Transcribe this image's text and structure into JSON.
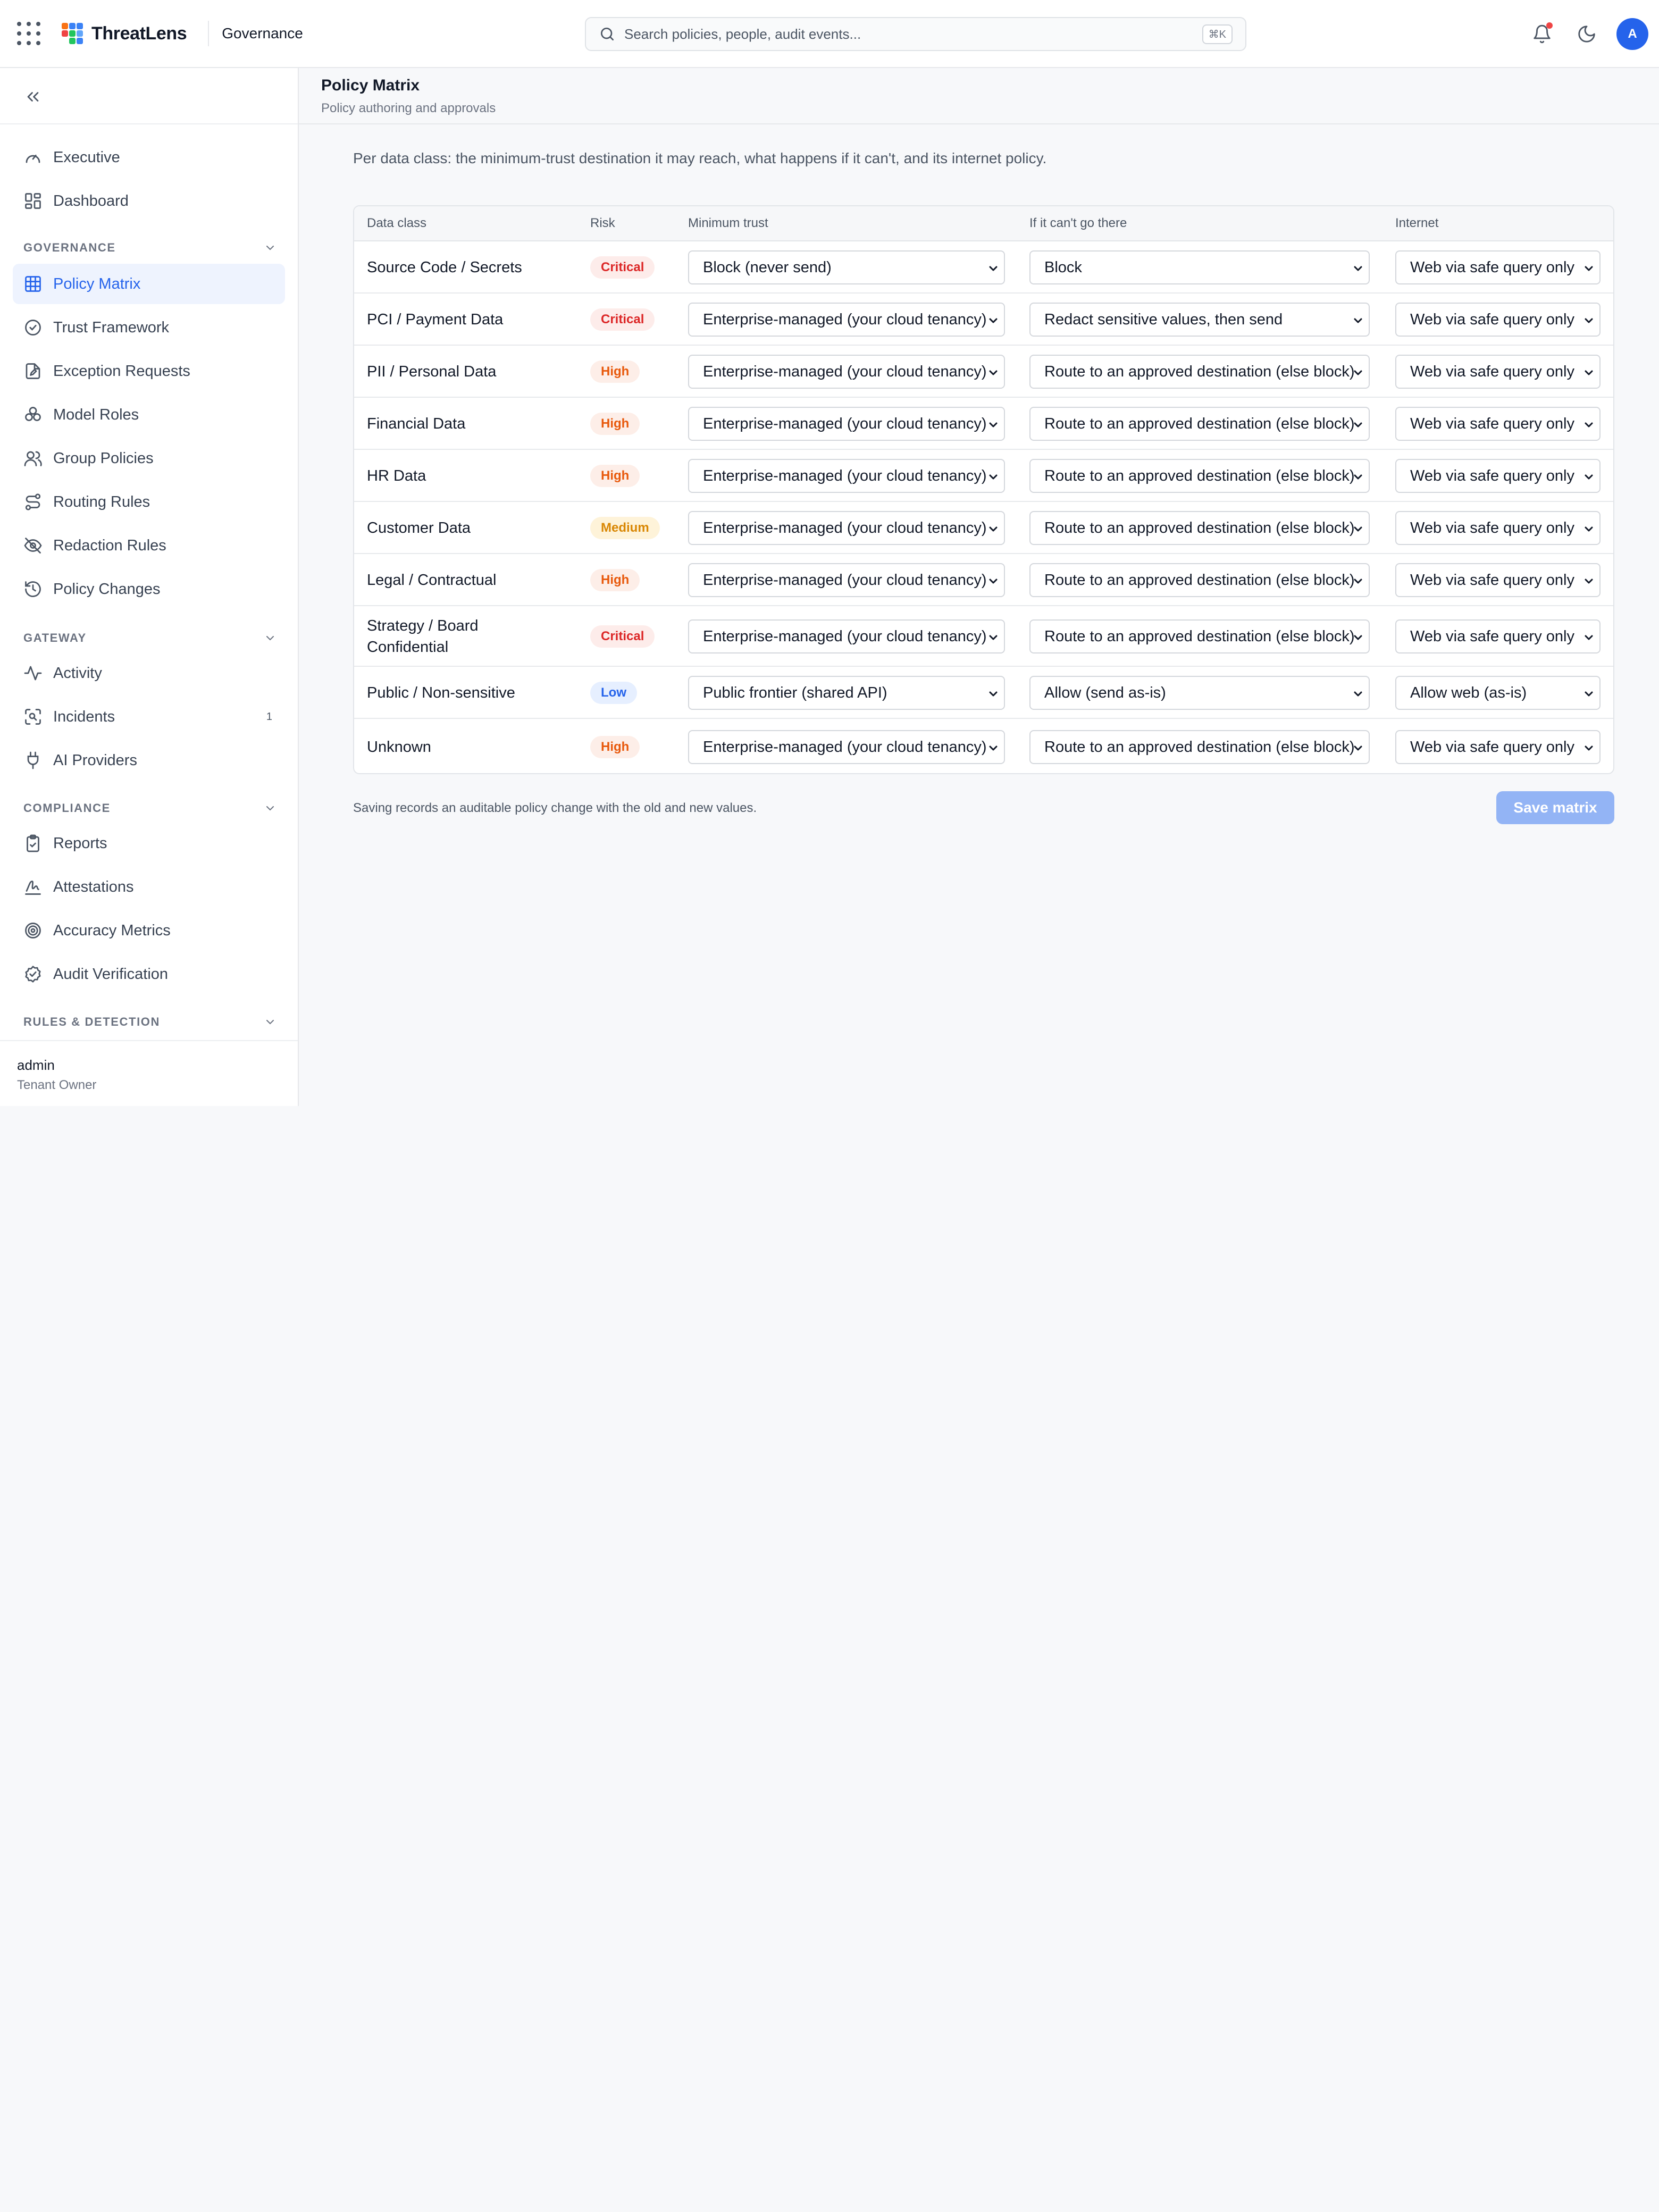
{
  "app": {
    "name": "ThreatLens",
    "section": "Governance"
  },
  "brand_colors": {
    "accent": "#2563eb",
    "critical": "#dc2626",
    "high": "#e8590c",
    "medium": "#d98704",
    "low": "#2563eb"
  },
  "search": {
    "placeholder": "Search policies, people, audit events...",
    "shortcut": "⌘K"
  },
  "sidebar": {
    "top_items": [
      {
        "label": "Executive",
        "icon": "gauge-icon"
      },
      {
        "label": "Dashboard",
        "icon": "dashboard-icon"
      }
    ],
    "groups": [
      {
        "label": "GOVERNANCE",
        "items": [
          {
            "label": "Policy Matrix",
            "icon": "grid-icon",
            "active": true
          },
          {
            "label": "Trust Framework",
            "icon": "check-circle-icon"
          },
          {
            "label": "Exception Requests",
            "icon": "file-edit-icon"
          },
          {
            "label": "Model Roles",
            "icon": "boxes-icon"
          },
          {
            "label": "Group Policies",
            "icon": "users-icon"
          },
          {
            "label": "Routing Rules",
            "icon": "route-icon"
          },
          {
            "label": "Redaction Rules",
            "icon": "eye-off-icon"
          },
          {
            "label": "Policy Changes",
            "icon": "history-icon"
          }
        ]
      },
      {
        "label": "GATEWAY",
        "items": [
          {
            "label": "Activity",
            "icon": "activity-icon"
          },
          {
            "label": "Incidents",
            "icon": "scan-icon",
            "badge": "1"
          },
          {
            "label": "AI Providers",
            "icon": "plug-icon"
          }
        ]
      },
      {
        "label": "COMPLIANCE",
        "items": [
          {
            "label": "Reports",
            "icon": "clipboard-check-icon"
          },
          {
            "label": "Attestations",
            "icon": "signature-icon"
          },
          {
            "label": "Accuracy Metrics",
            "icon": "target-icon"
          },
          {
            "label": "Audit Verification",
            "icon": "badge-check-icon"
          }
        ]
      },
      {
        "label": "RULES & DETECTION",
        "items": []
      }
    ],
    "user": {
      "name": "admin",
      "role": "Tenant Owner"
    }
  },
  "page": {
    "title": "Policy Matrix",
    "subtitle": "Policy authoring and approvals",
    "intro": "Per data class: the minimum-trust destination it may reach, what happens if it can't, and its internet policy."
  },
  "table": {
    "columns": [
      "Data class",
      "Risk",
      "Minimum trust",
      "If it can't go there",
      "Internet"
    ],
    "rows": [
      {
        "data_class": "Source Code / Secrets",
        "risk": "Critical",
        "min_trust": "Block (never send)",
        "fallback": "Block",
        "internet": "Web via safe query only"
      },
      {
        "data_class": "PCI / Payment Data",
        "risk": "Critical",
        "min_trust": "Enterprise-managed (your cloud tenancy)",
        "fallback": "Redact sensitive values, then send",
        "internet": "Web via safe query only"
      },
      {
        "data_class": "PII / Personal Data",
        "risk": "High",
        "min_trust": "Enterprise-managed (your cloud tenancy)",
        "fallback": "Route to an approved destination (else block)",
        "internet": "Web via safe query only"
      },
      {
        "data_class": "Financial Data",
        "risk": "High",
        "min_trust": "Enterprise-managed (your cloud tenancy)",
        "fallback": "Route to an approved destination (else block)",
        "internet": "Web via safe query only"
      },
      {
        "data_class": "HR Data",
        "risk": "High",
        "min_trust": "Enterprise-managed (your cloud tenancy)",
        "fallback": "Route to an approved destination (else block)",
        "internet": "Web via safe query only"
      },
      {
        "data_class": "Customer Data",
        "risk": "Medium",
        "min_trust": "Enterprise-managed (your cloud tenancy)",
        "fallback": "Route to an approved destination (else block)",
        "internet": "Web via safe query only"
      },
      {
        "data_class": "Legal / Contractual",
        "risk": "High",
        "min_trust": "Enterprise-managed (your cloud tenancy)",
        "fallback": "Route to an approved destination (else block)",
        "internet": "Web via safe query only"
      },
      {
        "data_class": "Strategy / Board Confidential",
        "risk": "Critical",
        "min_trust": "Enterprise-managed (your cloud tenancy)",
        "fallback": "Route to an approved destination (else block)",
        "internet": "Web via safe query only"
      },
      {
        "data_class": "Public / Non-sensitive",
        "risk": "Low",
        "min_trust": "Public frontier (shared API)",
        "fallback": "Allow (send as-is)",
        "internet": "Allow web (as-is)"
      },
      {
        "data_class": "Unknown",
        "risk": "High",
        "min_trust": "Enterprise-managed (your cloud tenancy)",
        "fallback": "Route to an approved destination (else block)",
        "internet": "Web via safe query only"
      }
    ]
  },
  "footer": {
    "note": "Saving records an auditable policy change with the old and new values.",
    "save_label": "Save matrix"
  },
  "avatar_initial": "A"
}
